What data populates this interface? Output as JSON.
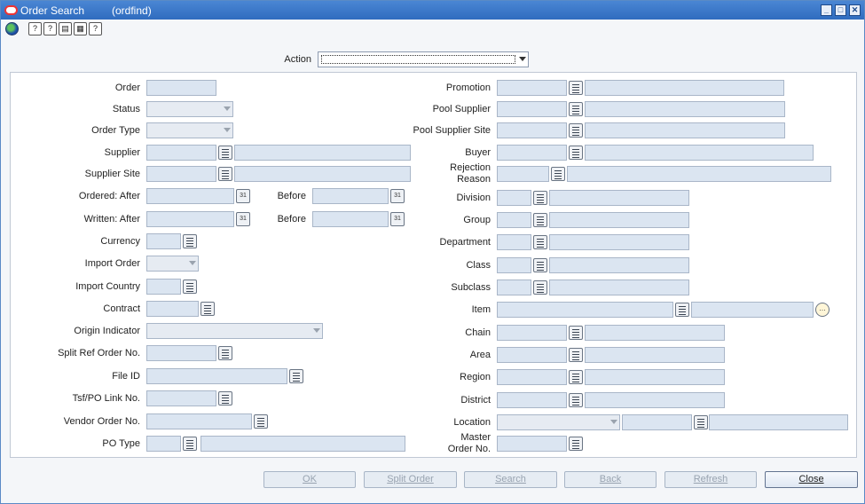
{
  "window": {
    "title": "Order Search",
    "form_id": "(ordfind)",
    "min_glyph": "_",
    "max_glyph": "□",
    "close_glyph": "✕"
  },
  "toolbar": {
    "icons": [
      "globe-icon",
      "help-icon",
      "hint-icon",
      "notes-icon",
      "print-icon",
      "whats-this-icon"
    ],
    "glyphs": {
      "help": "?",
      "hint": "?",
      "notes": "▤",
      "print": "▦",
      "whats": "?"
    }
  },
  "action": {
    "label": "Action",
    "value": ""
  },
  "left": {
    "order": "Order",
    "status": "Status",
    "order_type": "Order Type",
    "supplier": "Supplier",
    "supplier_site": "Supplier Site",
    "ordered_after": "Ordered:  After",
    "ordered_before": "Before",
    "written_after": "Written:  After",
    "written_before": "Before",
    "currency": "Currency",
    "import_order": "Import Order",
    "import_country": "Import Country",
    "contract": "Contract",
    "origin_indicator": "Origin Indicator",
    "split_ref": "Split Ref Order No.",
    "file_id": "File ID",
    "tsf_po": "Tsf/PO Link No.",
    "vendor_order": "Vendor Order No.",
    "po_type": "PO Type"
  },
  "right": {
    "promotion": "Promotion",
    "pool_supplier": "Pool Supplier",
    "pool_supplier_site": "Pool Supplier Site",
    "buyer": "Buyer",
    "rejection_reason": "Rejection Reason",
    "division": "Division",
    "group": "Group",
    "department": "Department",
    "class": "Class",
    "subclass": "Subclass",
    "item": "Item",
    "chain": "Chain",
    "area": "Area",
    "region": "Region",
    "district": "District",
    "location": "Location",
    "master_order": "Master Order No."
  },
  "buttons": {
    "ok": "OK",
    "split_order": "Split Order",
    "search": "Search",
    "back": "Back",
    "refresh": "Refresh",
    "close": "Close"
  },
  "calendar_glyph": "31",
  "item_desc_glyph": "…",
  "colors": {
    "titlebar": "#2f6cbf",
    "field_bg": "#dbe5f1",
    "field_border": "#a9b6c8"
  }
}
